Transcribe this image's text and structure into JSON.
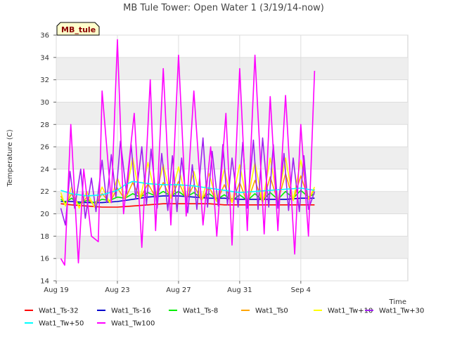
{
  "chart_data": {
    "type": "line",
    "title": "MB Tule Tower: Open Water 1 (3/19/14-now)",
    "xlabel": "Time",
    "ylabel": "Temperature (C)",
    "badge": "MB_tule",
    "xlim": [
      0,
      23
    ],
    "ylim": [
      14,
      36
    ],
    "y_ticks": [
      14,
      16,
      18,
      20,
      22,
      24,
      26,
      28,
      30,
      32,
      34,
      36
    ],
    "x_ticks": [
      {
        "value": 0,
        "label": "Aug 19"
      },
      {
        "value": 4,
        "label": "Aug 23"
      },
      {
        "value": 8,
        "label": "Aug 27"
      },
      {
        "value": 12,
        "label": "Aug 31"
      },
      {
        "value": 16,
        "label": "Sep 4"
      }
    ],
    "grid": true,
    "legend_position": "bottom",
    "series": [
      {
        "name": "Wat1_Ts-32",
        "color": "#ff0000",
        "x": [
          0.3,
          1,
          2,
          3,
          4,
          5,
          6,
          7,
          8,
          9,
          10,
          11,
          12,
          13,
          14,
          15,
          16,
          16.9
        ],
        "y": [
          20.9,
          20.8,
          20.7,
          20.6,
          20.6,
          20.7,
          20.8,
          20.9,
          20.9,
          20.9,
          20.9,
          20.8,
          20.8,
          20.8,
          20.8,
          20.8,
          20.8,
          20.8
        ]
      },
      {
        "name": "Wat1_Ts-16",
        "color": "#0000cc",
        "x": [
          0.3,
          1,
          2,
          3,
          4,
          5,
          6,
          7,
          8,
          9,
          10,
          11,
          12,
          13,
          14,
          15,
          16,
          16.9
        ],
        "y": [
          21.1,
          21.1,
          21.0,
          21.0,
          21.1,
          21.3,
          21.5,
          21.6,
          21.6,
          21.5,
          21.4,
          21.4,
          21.3,
          21.3,
          21.3,
          21.3,
          21.4,
          21.4
        ]
      },
      {
        "name": "Wat1_Ts-8",
        "color": "#00ee00",
        "x": [
          0.3,
          0.6,
          1,
          1.5,
          2,
          2.5,
          3,
          3.5,
          4,
          4.5,
          5,
          5.5,
          6,
          6.5,
          7,
          7.5,
          8,
          8.5,
          9,
          9.5,
          10,
          10.5,
          11,
          11.5,
          12,
          12.5,
          13,
          13.5,
          14,
          14.5,
          15,
          15.5,
          16,
          16.5,
          16.9
        ],
        "y": [
          21.3,
          21.0,
          21.4,
          20.9,
          21.2,
          21.0,
          21.3,
          21.2,
          21.5,
          21.4,
          21.8,
          21.5,
          21.9,
          21.6,
          22.0,
          21.6,
          22.0,
          21.5,
          21.9,
          21.4,
          21.8,
          21.3,
          21.7,
          21.2,
          21.7,
          21.2,
          21.8,
          21.2,
          21.9,
          21.3,
          22.0,
          21.4,
          22.1,
          21.5,
          21.8
        ]
      },
      {
        "name": "Wat1_Ts0",
        "color": "#ffa500",
        "x": [
          0.3,
          0.6,
          1,
          1.5,
          2,
          2.5,
          3,
          3.5,
          4,
          4.5,
          5,
          5.5,
          6,
          6.5,
          7,
          7.5,
          8,
          8.5,
          9,
          9.5,
          10,
          10.5,
          11,
          11.5,
          12,
          12.5,
          13,
          13.5,
          14,
          14.5,
          15,
          15.5,
          16,
          16.5,
          16.9
        ],
        "y": [
          21.6,
          20.8,
          21.8,
          20.6,
          21.5,
          20.7,
          21.8,
          21.0,
          22.3,
          21.3,
          22.8,
          21.4,
          22.7,
          21.5,
          22.8,
          21.4,
          22.9,
          21.3,
          22.6,
          21.2,
          22.4,
          21.1,
          22.6,
          21.0,
          22.8,
          21.0,
          23.0,
          21.0,
          23.3,
          21.1,
          23.6,
          21.2,
          23.4,
          21.3,
          22.2
        ]
      },
      {
        "name": "Wat1_Tw+10",
        "color": "#ffff00",
        "x": [
          0.3,
          0.6,
          1,
          1.5,
          2,
          2.5,
          3,
          3.5,
          4,
          4.5,
          5,
          5.5,
          6,
          6.5,
          7,
          7.5,
          8,
          8.5,
          9,
          9.5,
          10,
          10.5,
          11,
          11.5,
          12,
          12.5,
          13,
          13.5,
          14,
          14.5,
          15,
          15.5,
          16,
          16.5,
          16.9
        ],
        "y": [
          21.9,
          20.7,
          22.4,
          20.5,
          22.0,
          20.6,
          22.4,
          21.0,
          23.2,
          21.3,
          25.0,
          21.4,
          24.6,
          21.5,
          24.4,
          21.4,
          24.2,
          21.3,
          23.8,
          21.2,
          23.6,
          21.1,
          24.0,
          21.0,
          24.4,
          21.0,
          24.6,
          21.0,
          25.0,
          21.1,
          25.0,
          21.2,
          24.8,
          21.3,
          22.4
        ]
      },
      {
        "name": "Wat1_Tw+30",
        "color": "#a020f0",
        "x": [
          0.3,
          0.6,
          0.9,
          1.2,
          1.6,
          1.9,
          2.3,
          2.6,
          3.0,
          3.3,
          3.6,
          3.9,
          4.2,
          4.6,
          4.9,
          5.2,
          5.6,
          5.9,
          6.2,
          6.6,
          6.9,
          7.3,
          7.6,
          7.9,
          8.2,
          8.6,
          8.9,
          9.2,
          9.6,
          9.9,
          10.2,
          10.6,
          10.9,
          11.2,
          11.5,
          11.9,
          12.2,
          12.5,
          12.9,
          13.2,
          13.5,
          13.9,
          14.2,
          14.5,
          14.9,
          15.2,
          15.5,
          15.9,
          16.2,
          16.5,
          16.9
        ],
        "y": [
          20.5,
          19.0,
          23.8,
          20.5,
          24.0,
          19.6,
          23.2,
          20.2,
          24.8,
          21.0,
          25.3,
          21.5,
          26.5,
          21.8,
          26.2,
          21.3,
          26.0,
          20.8,
          25.8,
          20.5,
          25.4,
          20.3,
          25.2,
          20.2,
          25.0,
          20.1,
          24.4,
          20.4,
          26.8,
          20.6,
          25.6,
          20.7,
          26.2,
          20.8,
          25.0,
          20.6,
          26.4,
          20.5,
          26.6,
          20.4,
          26.8,
          20.6,
          26.2,
          20.5,
          25.4,
          20.3,
          25.0,
          20.2,
          25.2,
          20.4,
          22.0
        ]
      },
      {
        "name": "Wat1_Tw+50",
        "color": "#00ffff",
        "x": [
          0.3,
          1,
          2,
          3,
          4,
          4.5,
          5,
          6,
          7,
          8,
          9,
          10,
          11,
          12,
          13,
          14,
          15,
          16,
          16.9
        ],
        "y": [
          22.1,
          21.8,
          21.6,
          21.7,
          22.1,
          22.6,
          22.9,
          22.7,
          22.6,
          22.6,
          22.5,
          22.3,
          22.1,
          21.9,
          22.0,
          22.1,
          22.2,
          22.3,
          22.1
        ]
      },
      {
        "name": "Wat1_Tw100",
        "color": "#ff00ff",
        "x": [
          0.3,
          0.55,
          0.95,
          1.45,
          1.8,
          2.3,
          2.75,
          3.0,
          3.6,
          4.0,
          4.4,
          5.1,
          5.6,
          6.15,
          6.5,
          7.0,
          7.5,
          8.0,
          8.5,
          9.0,
          9.6,
          10.1,
          10.5,
          11.1,
          11.5,
          12.0,
          12.5,
          13.0,
          13.6,
          14.0,
          14.5,
          15.0,
          15.6,
          16.0,
          16.5,
          16.9
        ],
        "y": [
          16.0,
          15.4,
          28.0,
          15.6,
          24.0,
          18.0,
          17.5,
          31.0,
          21.0,
          35.6,
          20.0,
          29.0,
          17.0,
          32.0,
          18.5,
          33.0,
          19.0,
          34.2,
          19.8,
          31.0,
          19.0,
          26.0,
          18.0,
          29.0,
          17.2,
          33.0,
          18.5,
          34.2,
          18.2,
          30.5,
          18.5,
          30.6,
          16.4,
          28.0,
          18.0,
          32.8
        ]
      }
    ]
  },
  "legend": [
    {
      "name": "Wat1_Ts-32",
      "color": "#ff0000"
    },
    {
      "name": "Wat1_Ts-16",
      "color": "#0000cc"
    },
    {
      "name": "Wat1_Ts-8",
      "color": "#00ee00"
    },
    {
      "name": "Wat1_Ts0",
      "color": "#ffa500"
    },
    {
      "name": "Wat1_Tw+10",
      "color": "#ffff00"
    },
    {
      "name": "Wat1_Tw+30",
      "color": "#a020f0"
    },
    {
      "name": "Wat1_Tw+50",
      "color": "#00ffff"
    },
    {
      "name": "Wat1_Tw100",
      "color": "#ff00ff"
    }
  ]
}
